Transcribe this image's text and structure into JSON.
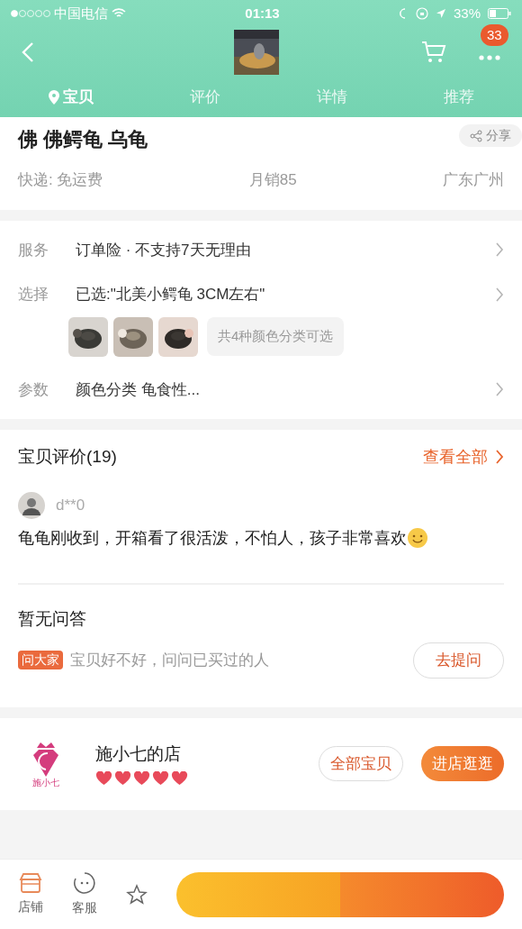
{
  "status_bar": {
    "carrier": "中国电信",
    "time": "01:13",
    "battery": "33%"
  },
  "header": {
    "badge": "33"
  },
  "tabs": [
    {
      "label": "宝贝",
      "selected": true
    },
    {
      "label": "评价",
      "selected": false
    },
    {
      "label": "详情",
      "selected": false
    },
    {
      "label": "推荐",
      "selected": false
    }
  ],
  "product": {
    "title": "佛 佛鳄龟 乌龟",
    "share": "分享",
    "shipping": "快递: 免运费",
    "monthly_sales": "月销85",
    "location": "广东广州"
  },
  "options": [
    {
      "kind": "text",
      "label": "服务",
      "value": "订单险 · 不支持7天无理由"
    },
    {
      "kind": "choice",
      "label": "选择",
      "value": "已选:\"北美小鳄龟 3CM左右\"",
      "note": "共4种颜色分类可选"
    },
    {
      "kind": "text",
      "label": "参数",
      "value": "颜色分类 龟食性..."
    }
  ],
  "reviews": {
    "title": "宝贝评价(19)",
    "view_all": "查看全部",
    "user": "d**0",
    "text": "龟龟刚收到，开箱看了很活泼，不怕人，孩子非常喜欢"
  },
  "qa": {
    "title": "暂无问答",
    "tag": "问大家",
    "prompt": "宝贝好不好，问问已买过的人",
    "button": "去提问"
  },
  "shop": {
    "logo_text": "施小七",
    "name": "施小七的店",
    "stars": 5,
    "all_items": "全部宝贝",
    "enter": "进店逛逛"
  },
  "bottom_nav": [
    {
      "kind": "shop",
      "label": "店铺"
    },
    {
      "kind": "service",
      "label": "客服"
    }
  ]
}
